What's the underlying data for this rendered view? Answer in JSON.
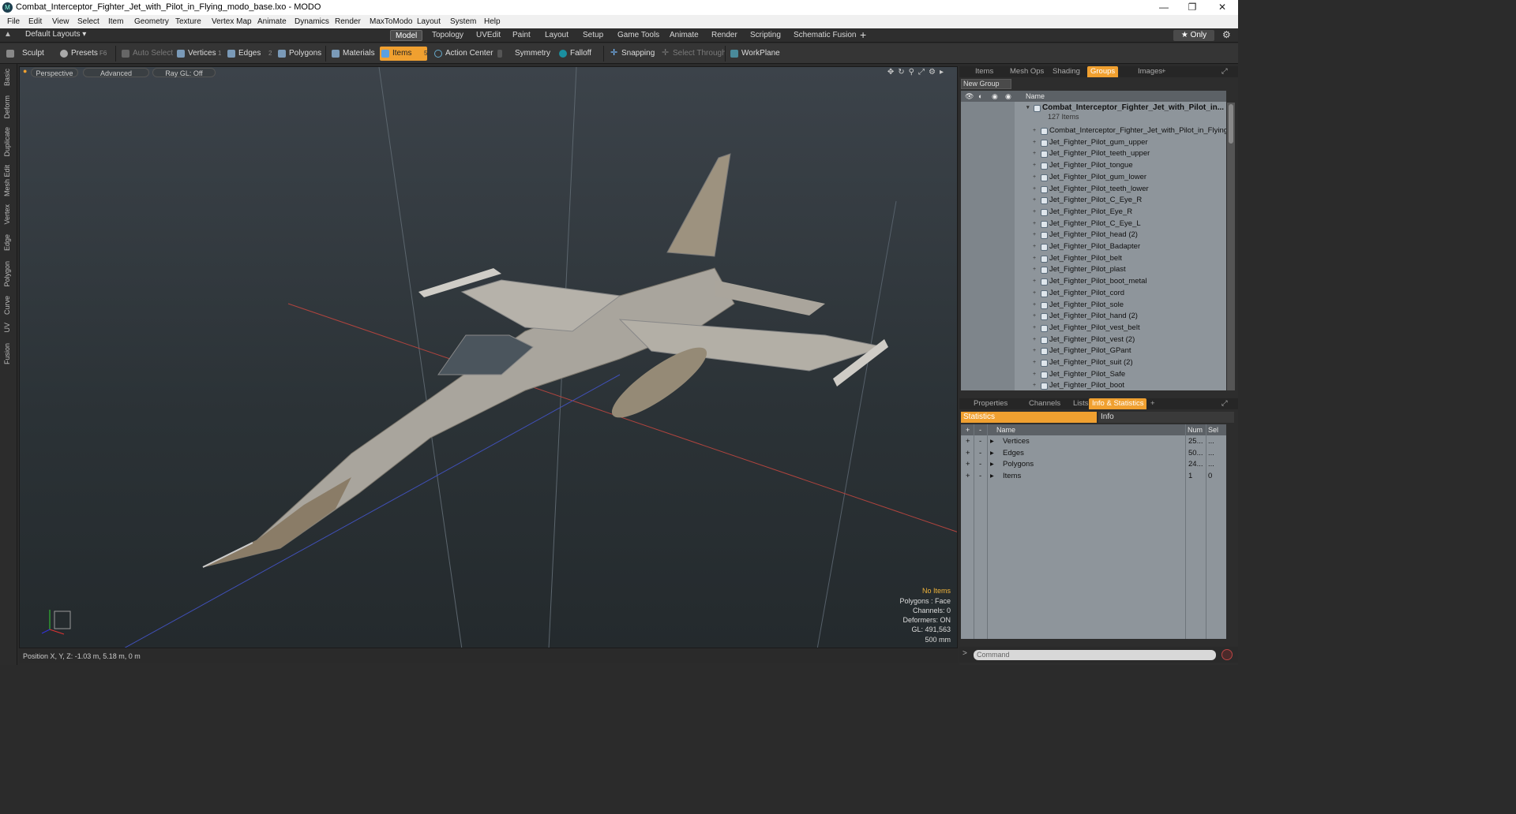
{
  "window": {
    "title": "Combat_Interceptor_Fighter_Jet_with_Pilot_in_Flying_modo_base.lxo - MODO"
  },
  "menu": [
    "File",
    "Edit",
    "View",
    "Select",
    "Item",
    "Geometry",
    "Texture",
    "Vertex Map",
    "Animate",
    "Dynamics",
    "Render",
    "MaxToModo",
    "Layout",
    "System",
    "Help"
  ],
  "modebar": {
    "layout_label": "Default Layouts ▾",
    "tabs": [
      "Model",
      "Topology",
      "UVEdit",
      "Paint",
      "Layout",
      "Setup",
      "Game Tools",
      "Animate",
      "Render",
      "Scripting",
      "Schematic Fusion"
    ],
    "active_tab": "Model",
    "only_label": "★ Only"
  },
  "toolbar": {
    "sculpt": "Sculpt",
    "presets": "Presets",
    "presets_key": "F6",
    "auto_select": "Auto Select",
    "vertices": "Vertices",
    "vertices_num": "1",
    "edges": "Edges",
    "edges_num": "2",
    "polygons": "Polygons",
    "materials": "Materials",
    "items": "Items",
    "items_num": "5",
    "action_center": "Action Center",
    "symmetry": "Symmetry",
    "falloff": "Falloff",
    "snapping": "Snapping",
    "select_through": "Select Through",
    "workplane": "WorkPlane"
  },
  "left_tabs": [
    "Basic",
    "Deform",
    "Duplicate",
    "Mesh Edit",
    "Vertex",
    "Edge",
    "Polygon",
    "Curve",
    "UV",
    "Fusion"
  ],
  "viewport": {
    "view_mode": "Perspective",
    "shading": "Advanced",
    "raygl": "Ray GL: Off",
    "info": {
      "selection": "No Items",
      "polygons": "Polygons : Face",
      "channels": "Channels: 0",
      "deformers": "Deformers: ON",
      "gl": "GL: 491,563",
      "scale": "500 mm"
    }
  },
  "status": {
    "position": "Position X, Y, Z:  -1.03 m, 5.18 m, 0 m"
  },
  "top_panel": {
    "tabs": [
      "Items",
      "Mesh Ops",
      "Shading",
      "Groups",
      "Images"
    ],
    "active": "Groups",
    "new_group": "New Group",
    "name_col": "Name",
    "root_name": "Combat_Interceptor_Fighter_Jet_with_Pilot_in...",
    "root_count": "127 Items",
    "items": [
      "Combat_Interceptor_Fighter_Jet_with_Pilot_in_Flying",
      "Jet_Fighter_Pilot_gum_upper",
      "Jet_Fighter_Pilot_teeth_upper",
      "Jet_Fighter_Pilot_tongue",
      "Jet_Fighter_Pilot_gum_lower",
      "Jet_Fighter_Pilot_teeth_lower",
      "Jet_Fighter_Pilot_C_Eye_R",
      "Jet_Fighter_Pilot_Eye_R",
      "Jet_Fighter_Pilot_C_Eye_L",
      "Jet_Fighter_Pilot_head (2)",
      "Jet_Fighter_Pilot_Badapter",
      "Jet_Fighter_Pilot_belt",
      "Jet_Fighter_Pilot_plast",
      "Jet_Fighter_Pilot_boot_metal",
      "Jet_Fighter_Pilot_cord",
      "Jet_Fighter_Pilot_sole",
      "Jet_Fighter_Pilot_hand (2)",
      "Jet_Fighter_Pilot_vest_belt",
      "Jet_Fighter_Pilot_vest (2)",
      "Jet_Fighter_Pilot_GPant",
      "Jet_Fighter_Pilot_suit (2)",
      "Jet_Fighter_Pilot_Safe",
      "Jet_Fighter_Pilot_boot"
    ]
  },
  "bottom_panel": {
    "tabs": [
      "Properties",
      "Channels",
      "Lists",
      "Info & Statistics"
    ],
    "active": "Info & Statistics",
    "sub_tabs": [
      "Statistics",
      "Info"
    ],
    "cols": {
      "name": "Name",
      "num": "Num",
      "sel": "Sel"
    },
    "rows": [
      {
        "name": "Vertices",
        "num": "25...",
        "sel": "..."
      },
      {
        "name": "Edges",
        "num": "50...",
        "sel": "..."
      },
      {
        "name": "Polygons",
        "num": "24...",
        "sel": "..."
      },
      {
        "name": "Items",
        "num": "1",
        "sel": "0"
      }
    ]
  },
  "command": {
    "placeholder": "Command"
  }
}
